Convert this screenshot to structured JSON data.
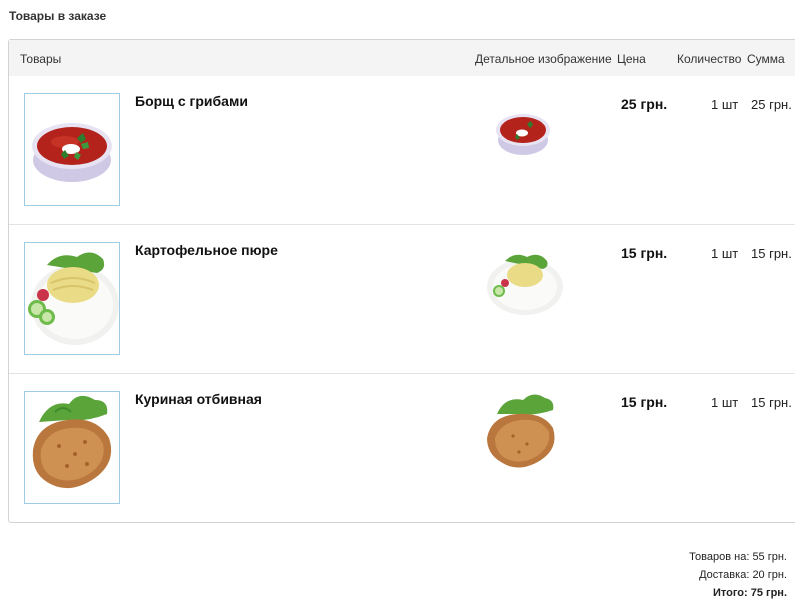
{
  "section_title": "Товары в заказе",
  "table": {
    "headers": {
      "goods": "Товары",
      "detail_image": "Детальное изображение",
      "price": "Цена",
      "quantity": "Количество",
      "sum": "Сумма"
    },
    "items": [
      {
        "name": "Борщ с грибами",
        "price": "25 грн.",
        "quantity": "1 шт",
        "sum": "25 грн.",
        "image_icon": "borscht-image"
      },
      {
        "name": "Картофельное пюре",
        "price": "15 грн.",
        "quantity": "1 шт",
        "sum": "15 грн.",
        "image_icon": "mashed-potatoes-image"
      },
      {
        "name": "Куриная отбивная",
        "price": "15 грн.",
        "quantity": "1 шт",
        "sum": "15 грн.",
        "image_icon": "chicken-cutlet-image"
      }
    ]
  },
  "totals": {
    "goods_label": "Товаров на:",
    "goods_value": "55 грн.",
    "delivery_label": "Доставка:",
    "delivery_value": "20 грн.",
    "total_label": "Итого:",
    "total_value": "75 грн."
  },
  "colors": {
    "header_bg": "#f4f4f4",
    "border": "#d3d3d3",
    "thumb_border": "#9ecbe6"
  }
}
